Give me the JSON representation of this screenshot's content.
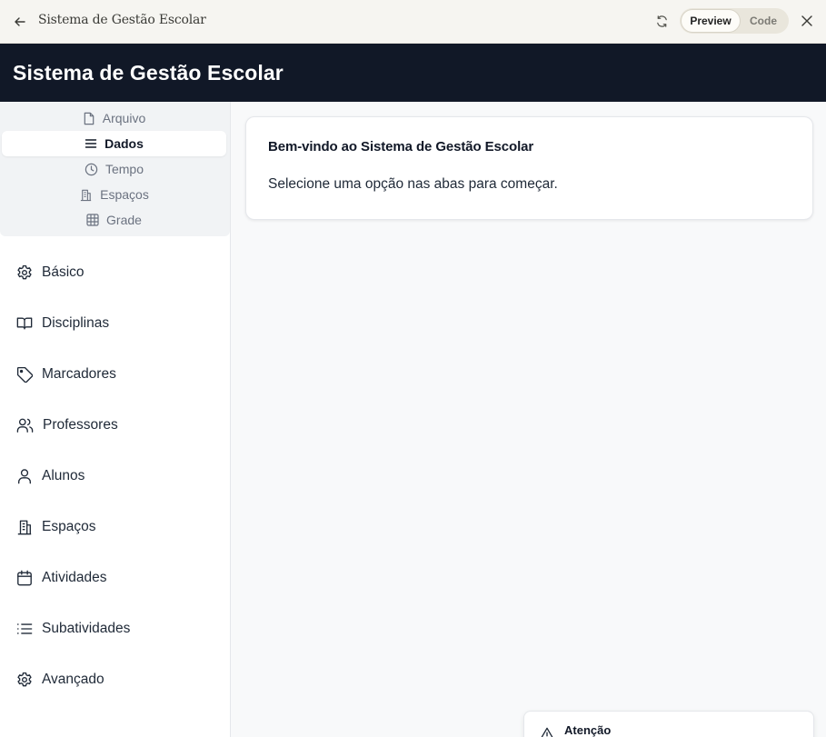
{
  "chrome": {
    "title": "Sistema de Gestão Escolar",
    "preview_label": "Preview",
    "code_label": "Code"
  },
  "header": {
    "title": "Sistema de Gestão Escolar"
  },
  "tabs": [
    {
      "label": "Arquivo",
      "icon": "file-icon",
      "active": false
    },
    {
      "label": "Dados",
      "icon": "menu-lines-icon",
      "active": true
    },
    {
      "label": "Tempo",
      "icon": "clock-icon",
      "active": false
    },
    {
      "label": "Espaços",
      "icon": "building-icon",
      "active": false
    },
    {
      "label": "Grade",
      "icon": "grid-icon",
      "active": false
    }
  ],
  "menu": [
    {
      "label": "Básico",
      "icon": "gear-icon"
    },
    {
      "label": "Disciplinas",
      "icon": "book-icon"
    },
    {
      "label": "Marcadores",
      "icon": "tag-icon"
    },
    {
      "label": "Professores",
      "icon": "users-icon"
    },
    {
      "label": "Alunos",
      "icon": "user-icon"
    },
    {
      "label": "Espaços",
      "icon": "building-icon"
    },
    {
      "label": "Atividades",
      "icon": "calendar-icon"
    },
    {
      "label": "Subatividades",
      "icon": "list-icon"
    },
    {
      "label": "Avançado",
      "icon": "gear-icon"
    }
  ],
  "welcome": {
    "title": "Bem-vindo ao Sistema de Gestão Escolar",
    "message": "Selecione uma opção nas abas para começar."
  },
  "toast": {
    "title": "Atenção",
    "icon": "warning-icon"
  },
  "colors": {
    "header_bg": "#111827",
    "tab_bar_bg": "#f1f3f5",
    "main_bg": "#f8f9fa"
  }
}
